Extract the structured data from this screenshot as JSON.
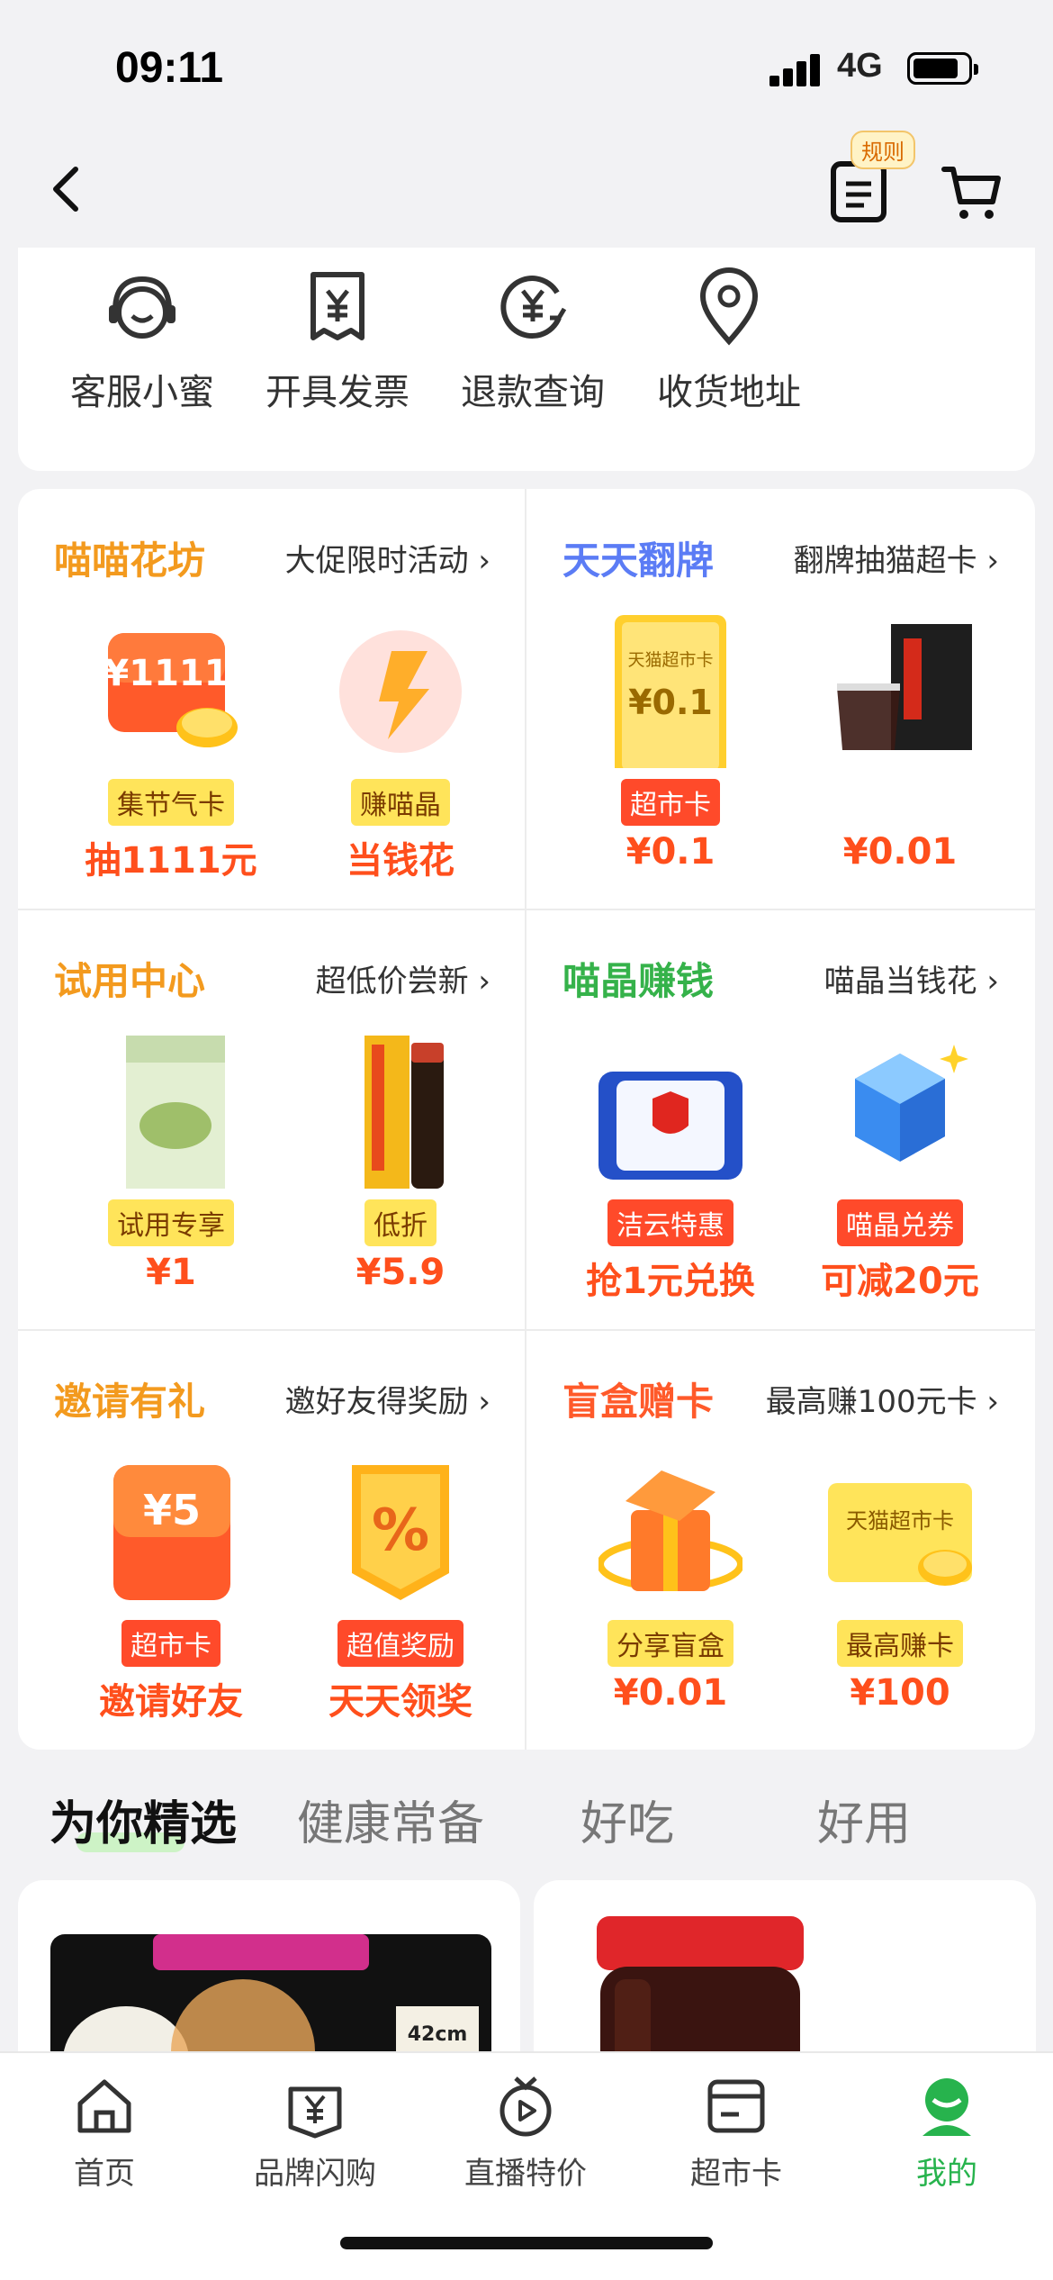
{
  "status_bar": {
    "time": "09:11",
    "network": "4G"
  },
  "nav": {
    "rules_badge": "规则"
  },
  "services": [
    {
      "label": "客服小蜜",
      "icon": "customer-service-icon"
    },
    {
      "label": "开具发票",
      "icon": "invoice-icon"
    },
    {
      "label": "退款查询",
      "icon": "refund-icon"
    },
    {
      "label": "收货地址",
      "icon": "location-pin-icon"
    }
  ],
  "promos": [
    {
      "title": "喵喵花坊",
      "subtitle": "大促限时活动",
      "title_color": "#f39a1e",
      "items": [
        {
          "tag": "集节气卡",
          "value": "抽1111元",
          "tag_style": "yellow",
          "pic_text": "¥1111"
        },
        {
          "tag": "赚喵晶",
          "value": "当钱花",
          "tag_style": "yellow"
        }
      ]
    },
    {
      "title": "天天翻牌",
      "subtitle": "翻牌抽猫超卡",
      "title_color": "#5b7cf5",
      "items": [
        {
          "tag": "超市卡",
          "value": "¥0.1",
          "tag_style": "red",
          "pic_text": "天猫超市卡",
          "pic_text2": "¥0.1"
        },
        {
          "tag": "",
          "value": "¥0.01",
          "tag_style": ""
        }
      ]
    },
    {
      "title": "试用中心",
      "subtitle": "超低价尝新",
      "title_color": "#f39a1e",
      "items": [
        {
          "tag": "试用专享",
          "value": "¥1",
          "tag_style": "yellow"
        },
        {
          "tag": "低折",
          "value": "¥5.9",
          "tag_style": "yellow"
        }
      ]
    },
    {
      "title": "喵晶赚钱",
      "subtitle": "喵晶当钱花",
      "title_color": "#35b24a",
      "items": [
        {
          "tag": "洁云特惠",
          "value": "抢1元兑换",
          "tag_style": "red"
        },
        {
          "tag": "喵晶兑券",
          "value": "可减20元",
          "tag_style": "red"
        }
      ]
    },
    {
      "title": "邀请有礼",
      "subtitle": "邀好友得奖励",
      "title_color": "#f39a1e",
      "items": [
        {
          "tag": "超市卡",
          "value": "邀请好友",
          "tag_style": "red",
          "pic_text": "¥5"
        },
        {
          "tag": "超值奖励",
          "value": "天天领奖",
          "tag_style": "red",
          "pic_text": "%"
        }
      ]
    },
    {
      "title": "盲盒赠卡",
      "subtitle": "最高赚100元卡",
      "title_color": "#ff5a2a",
      "items": [
        {
          "tag": "分享盲盒",
          "value": "¥0.01",
          "tag_style": "yellow"
        },
        {
          "tag": "最高赚卡",
          "value": "¥100",
          "tag_style": "yellow",
          "pic_text": "天猫超市卡"
        }
      ]
    }
  ],
  "tabs": [
    "为你精选",
    "健康常备",
    "好吃",
    "好用"
  ],
  "product_preview": {
    "size_label": "42cm"
  },
  "tabbar": [
    {
      "label": "首页",
      "icon": "home-icon"
    },
    {
      "label": "品牌闪购",
      "icon": "brand-flash-icon"
    },
    {
      "label": "直播特价",
      "icon": "live-play-icon"
    },
    {
      "label": "超市卡",
      "icon": "card-icon"
    },
    {
      "label": "我的",
      "icon": "profile-icon",
      "active": true
    }
  ],
  "colors": {
    "accent_green": "#27b34d",
    "price_red": "#ff4f1c"
  }
}
